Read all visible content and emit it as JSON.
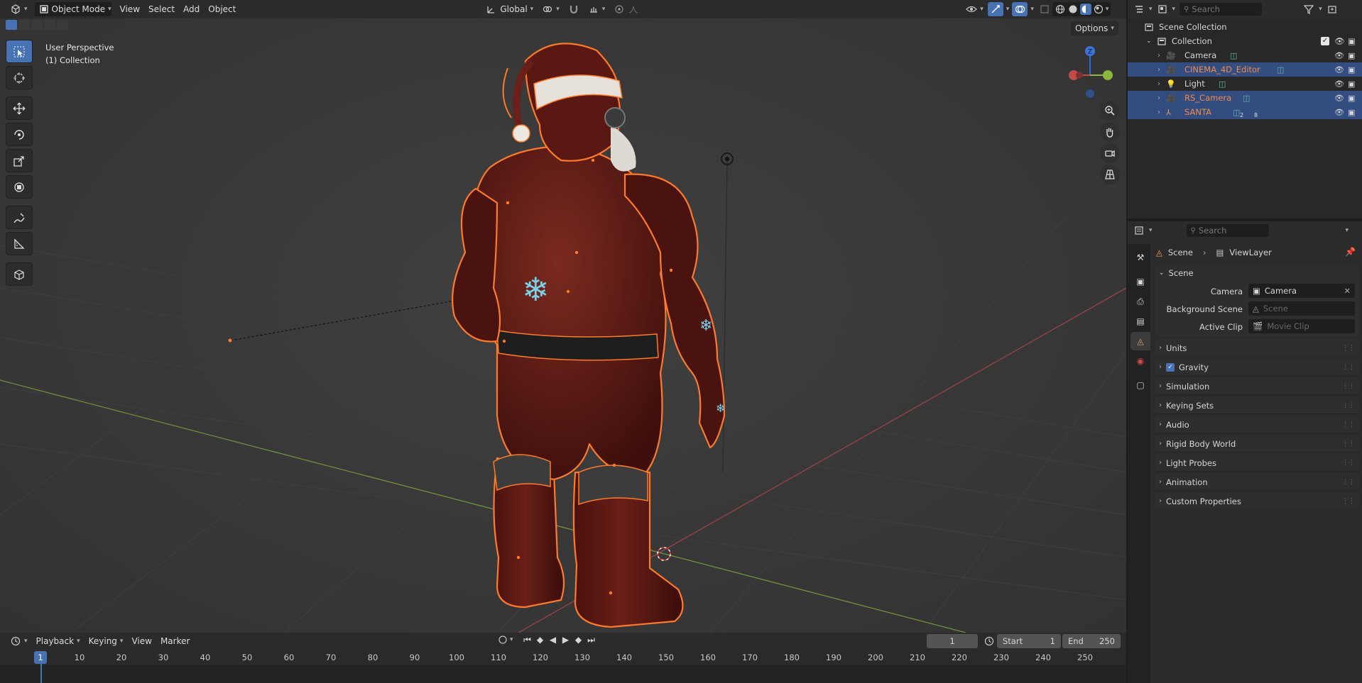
{
  "topbar": {
    "mode_label": "Object Mode",
    "menus": [
      "View",
      "Select",
      "Add",
      "Object"
    ],
    "transform_orientation": "Global",
    "viewport_options_label": "Options"
  },
  "viewport": {
    "perspective_label": "User Perspective",
    "collection_label": "(1) Collection",
    "axis_z_label": "Z"
  },
  "timeline": {
    "menus": [
      "Playback",
      "Keying",
      "View",
      "Marker"
    ],
    "current_frame": "1",
    "start_label": "Start",
    "start_value": "1",
    "end_label": "End",
    "end_value": "250",
    "ticks": [
      "10",
      "20",
      "30",
      "40",
      "50",
      "60",
      "70",
      "80",
      "90",
      "100",
      "110",
      "120",
      "130",
      "140",
      "150",
      "160",
      "170",
      "180",
      "190",
      "200",
      "210",
      "220",
      "230",
      "240",
      "250"
    ],
    "playhead_label": "1"
  },
  "outliner": {
    "search_placeholder": "Search",
    "scene_collection": "Scene Collection",
    "collection": "Collection",
    "items": [
      {
        "name": "Camera",
        "selected": false,
        "color": "#d6d6d6"
      },
      {
        "name": "CINEMA_4D_Editor",
        "selected": true,
        "color": "#f08a4b"
      },
      {
        "name": "Light",
        "selected": false,
        "color": "#d6d6d6"
      },
      {
        "name": "RS_Camera",
        "selected": true,
        "color": "#f08a4b"
      },
      {
        "name": "SANTA",
        "selected": true,
        "color": "#f08a4b"
      }
    ],
    "santa_badges": [
      "2",
      "8"
    ]
  },
  "properties": {
    "search_placeholder": "Search",
    "breadcrumb": [
      "Scene",
      "ViewLayer"
    ],
    "scene_panel_title": "Scene",
    "camera_label": "Camera",
    "camera_value": "Camera",
    "background_scene_label": "Background Scene",
    "background_scene_placeholder": "Scene",
    "active_clip_label": "Active Clip",
    "active_clip_placeholder": "Movie Clip",
    "panels": [
      "Units",
      "Gravity",
      "Simulation",
      "Keying Sets",
      "Audio",
      "Rigid Body World",
      "Light Probes",
      "Animation",
      "Custom Properties"
    ]
  },
  "colors": {
    "accent": "#4772b3",
    "selection_outline": "#ff7a2a",
    "selected_row": "#334d80",
    "axis_x": "#c24a4a",
    "axis_y": "#8ab53f"
  }
}
